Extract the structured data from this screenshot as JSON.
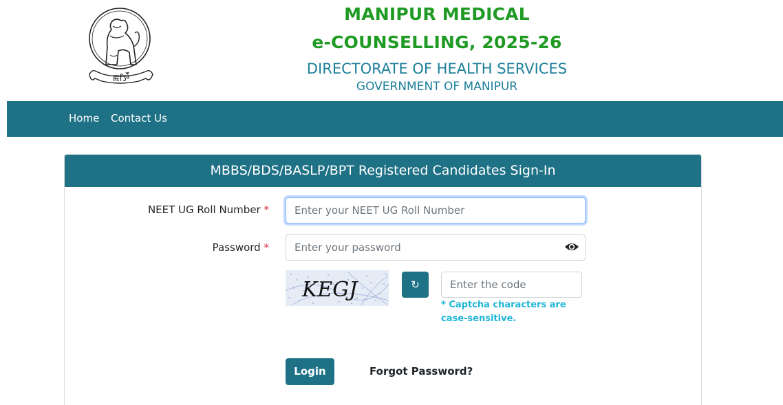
{
  "header": {
    "title_line1": "MANIPUR MEDICAL",
    "title_line2": "e-COUNSELLING, 2025-26",
    "department": "DIRECTORATE OF HEALTH SERVICES",
    "government": "GOVERNMENT OF MANIPUR",
    "emblem_icon": "manipur-state-emblem-icon",
    "emblem_script_text": "ꯃꯤꯇꯩ"
  },
  "nav": {
    "items": [
      {
        "label": "Home"
      },
      {
        "label": "Contact Us"
      }
    ]
  },
  "signin": {
    "title": "MBBS/BDS/BASLP/BPT Registered Candidates Sign-In",
    "roll_label": "NEET UG Roll Number",
    "roll_placeholder": "Enter your NEET UG Roll Number",
    "roll_value": "",
    "password_label": "Password",
    "password_placeholder": "Enter your password",
    "password_value": "",
    "required_mark": "*",
    "captcha_text": "KEGJ",
    "captcha_placeholder": "Enter the code",
    "captcha_note": "* Captcha characters are case-sensitive.",
    "refresh_icon": "refresh-icon",
    "eye_icon": "eye-icon",
    "login_label": "Login",
    "forgot_label": "Forgot Password?"
  },
  "colors": {
    "title_green": "#1f9a23",
    "subtitle_teal": "#1d7f9a",
    "nav_bg": "#1f7186",
    "note_cyan": "#1fb5d6",
    "required_red": "#dc3545"
  }
}
